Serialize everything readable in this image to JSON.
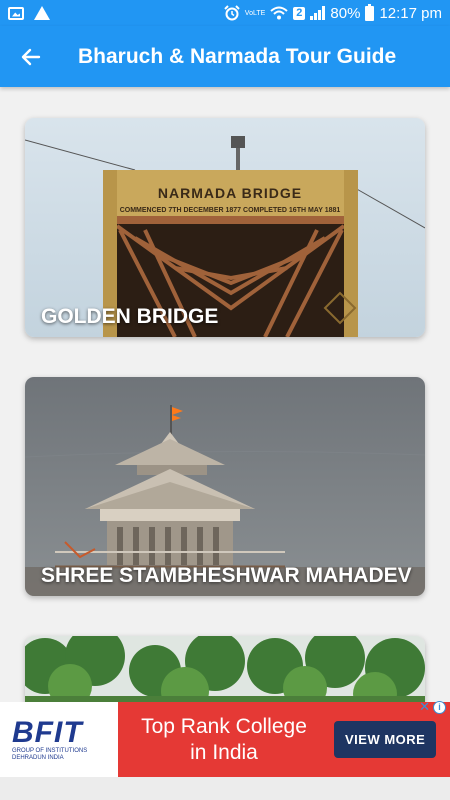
{
  "status_bar": {
    "volte_label": "VoLTE",
    "network_badge": "2",
    "battery_text": "80%",
    "time": "12:17 pm",
    "icons": [
      "gallery-icon",
      "warning-icon",
      "alarm-icon",
      "volte-icon",
      "wifi-icon",
      "signal-icon",
      "battery-icon"
    ]
  },
  "app_bar": {
    "title": "Bharuch & Narmada Tour Guide",
    "back_icon": "back-arrow-icon"
  },
  "places": [
    {
      "label": "GOLDEN BRIDGE",
      "sign_line1": "NARMADA BRIDGE",
      "sign_line2": "COMMENCED 7TH DECEMBER 1877 COMPLETED 16TH MAY 1881"
    },
    {
      "label": "SHREE STAMBHESHWAR MAHADEV"
    },
    {
      "label": ""
    }
  ],
  "ad": {
    "logo_text": "BFIT",
    "logo_sub1": "GROUP OF INSTITUTIONS",
    "logo_sub2": "DEHRADUN INDIA",
    "headline_line1": "Top Rank College",
    "headline_line2": "in India",
    "cta": "VIEW MORE",
    "info_icon": "info-icon",
    "close_icon": "close-icon"
  },
  "colors": {
    "primary": "#2196f3",
    "ad_red": "#e53935",
    "ad_button": "#1e3562",
    "logo_blue": "#1f3a8f"
  }
}
